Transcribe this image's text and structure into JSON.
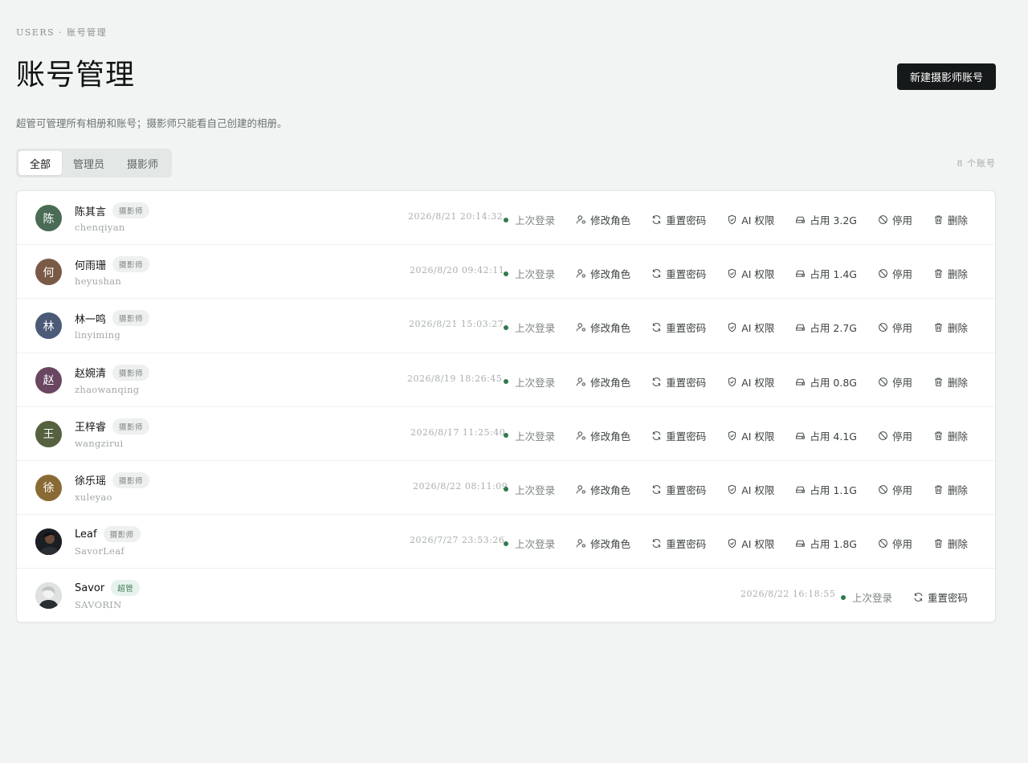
{
  "breadcrumb": "USERS · 账号管理",
  "title": "账号管理",
  "new_button": "新建摄影师账号",
  "subtitle": "超管可管理所有相册和账号；摄影师只能看自己创建的相册。",
  "tabs": [
    {
      "label": "全部",
      "active": true
    },
    {
      "label": "管理员",
      "active": false
    },
    {
      "label": "摄影师",
      "active": false
    }
  ],
  "count_text": "8 个账号",
  "labels": {
    "last_login": "上次登录",
    "change_role": "修改角色",
    "reset_password": "重置密码",
    "ai_permission": "AI 权限",
    "storage_prefix": "占用",
    "disable": "停用",
    "delete": "删除"
  },
  "colors": {
    "accent_dark": "#16191a",
    "status_green": "#2f7a4c",
    "background": "#f1f4f3"
  },
  "users": [
    {
      "avatar_text": "陈",
      "avatar_color": "#4a6b55",
      "name": "陈其言",
      "role": "摄影师",
      "login": "chenqiyan",
      "last_login_time": "2026/8/21 20:14:32",
      "storage": "占用 3.2G",
      "is_super": false
    },
    {
      "avatar_text": "何",
      "avatar_color": "#7a5a47",
      "name": "何雨珊",
      "role": "摄影师",
      "login": "heyushan",
      "last_login_time": "2026/8/20 09:42:11",
      "storage": "占用 1.4G",
      "is_super": false
    },
    {
      "avatar_text": "林",
      "avatar_color": "#4b5a76",
      "name": "林一鸣",
      "role": "摄影师",
      "login": "linyiming",
      "last_login_time": "2026/8/21 15:03:27",
      "storage": "占用 2.7G",
      "is_super": false
    },
    {
      "avatar_text": "赵",
      "avatar_color": "#6a4660",
      "name": "赵婉清",
      "role": "摄影师",
      "login": "zhaowanqing",
      "last_login_time": "2026/8/19 18:26:45",
      "storage": "占用 0.8G",
      "is_super": false
    },
    {
      "avatar_text": "王",
      "avatar_color": "#55613f",
      "name": "王梓睿",
      "role": "摄影师",
      "login": "wangzirui",
      "last_login_time": "2026/8/17 11:25:40",
      "storage": "占用 4.1G",
      "is_super": false
    },
    {
      "avatar_text": "徐",
      "avatar_color": "#8a6a34",
      "name": "徐乐瑶",
      "role": "摄影师",
      "login": "xuleyao",
      "last_login_time": "2026/8/22 08:11:09",
      "storage": "占用 1.1G",
      "is_super": false
    },
    {
      "avatar_text": "",
      "avatar_color": "#1e2226",
      "name": "Leaf",
      "role": "摄影师",
      "login": "SavorLeaf",
      "last_login_time": "2026/7/27 23:53:26",
      "storage": "占用 1.8G",
      "is_super": false
    },
    {
      "avatar_text": "",
      "avatar_color": "#c9ccca",
      "name": "Savor",
      "role": "超管",
      "login": "SAVORIN",
      "last_login_time": "2026/8/22 16:18:55",
      "storage": "",
      "is_super": true
    }
  ]
}
